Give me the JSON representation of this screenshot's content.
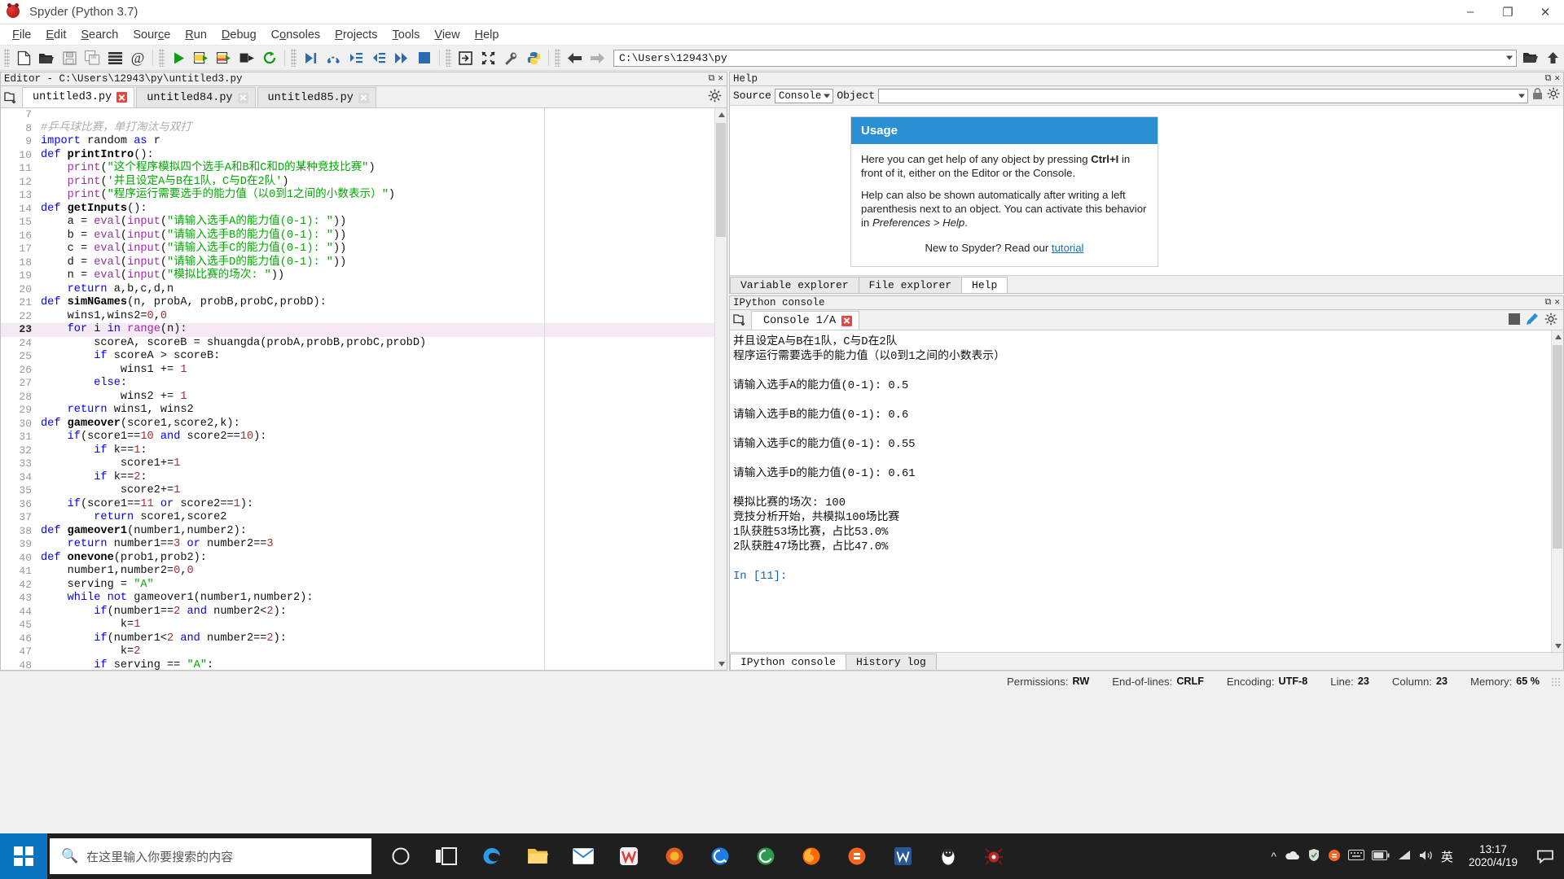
{
  "window": {
    "title": "Spyder (Python 3.7)",
    "buttons": {
      "minimize": "–",
      "maximize": "❐",
      "close": "✕"
    }
  },
  "menubar": [
    {
      "label": "File"
    },
    {
      "label": "Edit"
    },
    {
      "label": "Search"
    },
    {
      "label": "Source"
    },
    {
      "label": "Run"
    },
    {
      "label": "Debug"
    },
    {
      "label": "Consoles"
    },
    {
      "label": "Projects"
    },
    {
      "label": "Tools"
    },
    {
      "label": "View"
    },
    {
      "label": "Help"
    }
  ],
  "toolbar": {
    "path_value": "C:\\Users\\12943\\py",
    "icons": [
      "new-file-icon",
      "open-file-icon",
      "save-file-icon",
      "save-all-icon",
      "file-switcher-icon",
      "find-symbol-icon",
      "run-file-icon",
      "run-cell-icon",
      "run-cell-advance-icon",
      "run-selection-icon",
      "rerun-icon",
      "debug-file-icon",
      "step-over-icon",
      "step-into-icon",
      "step-return-icon",
      "continue-icon",
      "stop-debug-icon",
      "maximize-pane-icon",
      "fullscreen-icon",
      "preferences-icon",
      "pythonpath-icon",
      "back-icon",
      "forward-icon"
    ]
  },
  "editor": {
    "pane_title": "Editor - C:\\Users\\12943\\py\\untitled3.py",
    "tabs": [
      {
        "label": "untitled3.py",
        "active": true
      },
      {
        "label": "untitled84.py",
        "active": false
      },
      {
        "label": "untitled85.py",
        "active": false
      }
    ],
    "current_line": 23,
    "lines": [
      {
        "n": 7,
        "segs": []
      },
      {
        "n": 8,
        "segs": [
          {
            "t": "#乒乓球比赛，单打淘汰与双打",
            "c": "cm"
          }
        ]
      },
      {
        "n": 9,
        "segs": [
          {
            "t": "import",
            "c": "kw"
          },
          {
            "t": " random ",
            "c": "op"
          },
          {
            "t": "as",
            "c": "kw"
          },
          {
            "t": " r",
            "c": "op"
          }
        ]
      },
      {
        "n": 10,
        "segs": [
          {
            "t": "def ",
            "c": "kw"
          },
          {
            "t": "printIntro",
            "c": "fn"
          },
          {
            "t": "():",
            "c": "op"
          }
        ]
      },
      {
        "n": 11,
        "segs": [
          {
            "t": "    ",
            "c": "op"
          },
          {
            "t": "print",
            "c": "bi"
          },
          {
            "t": "(",
            "c": "op"
          },
          {
            "t": "\"这个程序模拟四个选手A和B和C和D的某种竞技比赛\"",
            "c": "st"
          },
          {
            "t": ")",
            "c": "op"
          }
        ]
      },
      {
        "n": 12,
        "segs": [
          {
            "t": "    ",
            "c": "op"
          },
          {
            "t": "print",
            "c": "bi"
          },
          {
            "t": "(",
            "c": "op"
          },
          {
            "t": "'并且设定A与B在1队，C与D在2队'",
            "c": "st"
          },
          {
            "t": ")",
            "c": "op"
          }
        ]
      },
      {
        "n": 13,
        "segs": [
          {
            "t": "    ",
            "c": "op"
          },
          {
            "t": "print",
            "c": "bi"
          },
          {
            "t": "(",
            "c": "op"
          },
          {
            "t": "\"程序运行需要选手的能力值（以0到1之间的小数表示）\"",
            "c": "st"
          },
          {
            "t": ")",
            "c": "op"
          }
        ]
      },
      {
        "n": 14,
        "segs": [
          {
            "t": "def ",
            "c": "kw"
          },
          {
            "t": "getInputs",
            "c": "fn"
          },
          {
            "t": "():",
            "c": "op"
          }
        ]
      },
      {
        "n": 15,
        "segs": [
          {
            "t": "    a = ",
            "c": "op"
          },
          {
            "t": "eval",
            "c": "bi"
          },
          {
            "t": "(",
            "c": "op"
          },
          {
            "t": "input",
            "c": "bi"
          },
          {
            "t": "(",
            "c": "op"
          },
          {
            "t": "\"请输入选手A的能力值(0-1): \"",
            "c": "st"
          },
          {
            "t": "))",
            "c": "op"
          }
        ]
      },
      {
        "n": 16,
        "segs": [
          {
            "t": "    b = ",
            "c": "op"
          },
          {
            "t": "eval",
            "c": "bi"
          },
          {
            "t": "(",
            "c": "op"
          },
          {
            "t": "input",
            "c": "bi"
          },
          {
            "t": "(",
            "c": "op"
          },
          {
            "t": "\"请输入选手B的能力值(0-1): \"",
            "c": "st"
          },
          {
            "t": "))",
            "c": "op"
          }
        ]
      },
      {
        "n": 17,
        "segs": [
          {
            "t": "    c = ",
            "c": "op"
          },
          {
            "t": "eval",
            "c": "bi"
          },
          {
            "t": "(",
            "c": "op"
          },
          {
            "t": "input",
            "c": "bi"
          },
          {
            "t": "(",
            "c": "op"
          },
          {
            "t": "\"请输入选手C的能力值(0-1): \"",
            "c": "st"
          },
          {
            "t": "))",
            "c": "op"
          }
        ]
      },
      {
        "n": 18,
        "segs": [
          {
            "t": "    d = ",
            "c": "op"
          },
          {
            "t": "eval",
            "c": "bi"
          },
          {
            "t": "(",
            "c": "op"
          },
          {
            "t": "input",
            "c": "bi"
          },
          {
            "t": "(",
            "c": "op"
          },
          {
            "t": "\"请输入选手D的能力值(0-1): \"",
            "c": "st"
          },
          {
            "t": "))",
            "c": "op"
          }
        ]
      },
      {
        "n": 19,
        "segs": [
          {
            "t": "    n = ",
            "c": "op"
          },
          {
            "t": "eval",
            "c": "bi"
          },
          {
            "t": "(",
            "c": "op"
          },
          {
            "t": "input",
            "c": "bi"
          },
          {
            "t": "(",
            "c": "op"
          },
          {
            "t": "\"模拟比赛的场次: \"",
            "c": "st"
          },
          {
            "t": "))",
            "c": "op"
          }
        ]
      },
      {
        "n": 20,
        "segs": [
          {
            "t": "    ",
            "c": "op"
          },
          {
            "t": "return",
            "c": "kw"
          },
          {
            "t": " a,b,c,d,n",
            "c": "op"
          }
        ]
      },
      {
        "n": 21,
        "segs": [
          {
            "t": "def ",
            "c": "kw"
          },
          {
            "t": "simNGames",
            "c": "fn"
          },
          {
            "t": "(n, probA, probB,probC,probD):",
            "c": "op"
          }
        ]
      },
      {
        "n": 22,
        "segs": [
          {
            "t": "    wins1,wins2=",
            "c": "op"
          },
          {
            "t": "0",
            "c": "nm"
          },
          {
            "t": ",",
            "c": "op"
          },
          {
            "t": "0",
            "c": "nm"
          }
        ]
      },
      {
        "n": 23,
        "segs": [
          {
            "t": "    ",
            "c": "op"
          },
          {
            "t": "for",
            "c": "kw"
          },
          {
            "t": " i ",
            "c": "op"
          },
          {
            "t": "in",
            "c": "kw"
          },
          {
            "t": " ",
            "c": "op"
          },
          {
            "t": "range",
            "c": "bi"
          },
          {
            "t": "(n):",
            "c": "op"
          }
        ]
      },
      {
        "n": 24,
        "segs": [
          {
            "t": "        scoreA, scoreB = shuangda(probA,probB,probC,probD)",
            "c": "op"
          }
        ]
      },
      {
        "n": 25,
        "segs": [
          {
            "t": "        ",
            "c": "op"
          },
          {
            "t": "if",
            "c": "kw"
          },
          {
            "t": " scoreA > scoreB:",
            "c": "op"
          }
        ]
      },
      {
        "n": 26,
        "segs": [
          {
            "t": "            wins1 += ",
            "c": "op"
          },
          {
            "t": "1",
            "c": "nm"
          }
        ]
      },
      {
        "n": 27,
        "segs": [
          {
            "t": "        ",
            "c": "op"
          },
          {
            "t": "else",
            "c": "kw"
          },
          {
            "t": ":",
            "c": "op"
          }
        ]
      },
      {
        "n": 28,
        "segs": [
          {
            "t": "            wins2 += ",
            "c": "op"
          },
          {
            "t": "1",
            "c": "nm"
          }
        ]
      },
      {
        "n": 29,
        "segs": [
          {
            "t": "    ",
            "c": "op"
          },
          {
            "t": "return",
            "c": "kw"
          },
          {
            "t": " wins1, wins2",
            "c": "op"
          }
        ]
      },
      {
        "n": 30,
        "segs": [
          {
            "t": "def ",
            "c": "kw"
          },
          {
            "t": "gameover",
            "c": "fn"
          },
          {
            "t": "(score1,score2,k):",
            "c": "op"
          }
        ]
      },
      {
        "n": 31,
        "segs": [
          {
            "t": "    ",
            "c": "op"
          },
          {
            "t": "if",
            "c": "kw"
          },
          {
            "t": "(score1==",
            "c": "op"
          },
          {
            "t": "10",
            "c": "nm"
          },
          {
            "t": " ",
            "c": "op"
          },
          {
            "t": "and",
            "c": "kw"
          },
          {
            "t": " score2==",
            "c": "op"
          },
          {
            "t": "10",
            "c": "nm"
          },
          {
            "t": "):",
            "c": "op"
          }
        ]
      },
      {
        "n": 32,
        "segs": [
          {
            "t": "        ",
            "c": "op"
          },
          {
            "t": "if",
            "c": "kw"
          },
          {
            "t": " k==",
            "c": "op"
          },
          {
            "t": "1",
            "c": "nm"
          },
          {
            "t": ":",
            "c": "op"
          }
        ]
      },
      {
        "n": 33,
        "segs": [
          {
            "t": "            score1+=",
            "c": "op"
          },
          {
            "t": "1",
            "c": "nm"
          }
        ]
      },
      {
        "n": 34,
        "segs": [
          {
            "t": "        ",
            "c": "op"
          },
          {
            "t": "if",
            "c": "kw"
          },
          {
            "t": " k==",
            "c": "op"
          },
          {
            "t": "2",
            "c": "nm"
          },
          {
            "t": ":",
            "c": "op"
          }
        ]
      },
      {
        "n": 35,
        "segs": [
          {
            "t": "            score2+=",
            "c": "op"
          },
          {
            "t": "1",
            "c": "nm"
          }
        ]
      },
      {
        "n": 36,
        "segs": [
          {
            "t": "    ",
            "c": "op"
          },
          {
            "t": "if",
            "c": "kw"
          },
          {
            "t": "(score1==",
            "c": "op"
          },
          {
            "t": "11",
            "c": "nm"
          },
          {
            "t": " ",
            "c": "op"
          },
          {
            "t": "or",
            "c": "kw"
          },
          {
            "t": " score2==",
            "c": "op"
          },
          {
            "t": "1",
            "c": "nm"
          },
          {
            "t": "):",
            "c": "op"
          }
        ]
      },
      {
        "n": 37,
        "segs": [
          {
            "t": "        ",
            "c": "op"
          },
          {
            "t": "return",
            "c": "kw"
          },
          {
            "t": " score1,score2",
            "c": "op"
          }
        ]
      },
      {
        "n": 38,
        "segs": [
          {
            "t": "def ",
            "c": "kw"
          },
          {
            "t": "gameover1",
            "c": "fn"
          },
          {
            "t": "(number1,number2):",
            "c": "op"
          }
        ]
      },
      {
        "n": 39,
        "segs": [
          {
            "t": "    ",
            "c": "op"
          },
          {
            "t": "return",
            "c": "kw"
          },
          {
            "t": " number1==",
            "c": "op"
          },
          {
            "t": "3",
            "c": "nm"
          },
          {
            "t": " ",
            "c": "op"
          },
          {
            "t": "or",
            "c": "kw"
          },
          {
            "t": " number2==",
            "c": "op"
          },
          {
            "t": "3",
            "c": "nm"
          }
        ]
      },
      {
        "n": 40,
        "segs": [
          {
            "t": "def ",
            "c": "kw"
          },
          {
            "t": "onevone",
            "c": "fn"
          },
          {
            "t": "(prob1,prob2):",
            "c": "op"
          }
        ]
      },
      {
        "n": 41,
        "segs": [
          {
            "t": "    number1,number2=",
            "c": "op"
          },
          {
            "t": "0",
            "c": "nm"
          },
          {
            "t": ",",
            "c": "op"
          },
          {
            "t": "0",
            "c": "nm"
          }
        ]
      },
      {
        "n": 42,
        "segs": [
          {
            "t": "    serving = ",
            "c": "op"
          },
          {
            "t": "\"A\"",
            "c": "st"
          }
        ]
      },
      {
        "n": 43,
        "segs": [
          {
            "t": "    ",
            "c": "op"
          },
          {
            "t": "while",
            "c": "kw"
          },
          {
            "t": " ",
            "c": "op"
          },
          {
            "t": "not",
            "c": "kw"
          },
          {
            "t": " gameover1(number1,number2):",
            "c": "op"
          }
        ]
      },
      {
        "n": 44,
        "segs": [
          {
            "t": "        ",
            "c": "op"
          },
          {
            "t": "if",
            "c": "kw"
          },
          {
            "t": "(number1==",
            "c": "op"
          },
          {
            "t": "2",
            "c": "nm"
          },
          {
            "t": " ",
            "c": "op"
          },
          {
            "t": "and",
            "c": "kw"
          },
          {
            "t": " number2<",
            "c": "op"
          },
          {
            "t": "2",
            "c": "nm"
          },
          {
            "t": "):",
            "c": "op"
          }
        ]
      },
      {
        "n": 45,
        "segs": [
          {
            "t": "            k=",
            "c": "op"
          },
          {
            "t": "1",
            "c": "nm"
          }
        ]
      },
      {
        "n": 46,
        "segs": [
          {
            "t": "        ",
            "c": "op"
          },
          {
            "t": "if",
            "c": "kw"
          },
          {
            "t": "(number1<",
            "c": "op"
          },
          {
            "t": "2",
            "c": "nm"
          },
          {
            "t": " ",
            "c": "op"
          },
          {
            "t": "and",
            "c": "kw"
          },
          {
            "t": " number2==",
            "c": "op"
          },
          {
            "t": "2",
            "c": "nm"
          },
          {
            "t": "):",
            "c": "op"
          }
        ]
      },
      {
        "n": 47,
        "segs": [
          {
            "t": "            k=",
            "c": "op"
          },
          {
            "t": "2",
            "c": "nm"
          }
        ]
      },
      {
        "n": 48,
        "segs": [
          {
            "t": "        ",
            "c": "op"
          },
          {
            "t": "if",
            "c": "kw"
          },
          {
            "t": " serving == ",
            "c": "op"
          },
          {
            "t": "\"A\"",
            "c": "st"
          },
          {
            "t": ":",
            "c": "op"
          }
        ]
      }
    ]
  },
  "help": {
    "pane_title": "Help",
    "source_label": "Source",
    "source_value": "Console",
    "object_label": "Object",
    "object_value": "",
    "card": {
      "heading": "Usage",
      "p1_a": "Here you can get help of any object by pressing ",
      "p1_b": "Ctrl+I",
      "p1_c": " in front of it, either on the Editor or the Console.",
      "p2_a": "Help can also be shown automatically after writing a left parenthesis next to an object. You can activate this behavior in ",
      "p2_b": "Preferences > Help",
      "p2_c": ".",
      "p3_a": "New to Spyder? Read our ",
      "p3_link": "tutorial"
    },
    "tabs": [
      {
        "label": "Variable explorer",
        "active": false
      },
      {
        "label": "File explorer",
        "active": false
      },
      {
        "label": "Help",
        "active": true
      }
    ]
  },
  "console": {
    "pane_title": "IPython console",
    "tab_label": "Console 1/A",
    "output": [
      "并且设定A与B在1队，C与D在2队",
      "程序运行需要选手的能力值（以0到1之间的小数表示）",
      "",
      "请输入选手A的能力值(0-1): 0.5",
      "",
      "请输入选手B的能力值(0-1): 0.6",
      "",
      "请输入选手C的能力值(0-1): 0.55",
      "",
      "请输入选手D的能力值(0-1): 0.61",
      "",
      "模拟比赛的场次: 100",
      "竞技分析开始，共模拟100场比赛",
      "1队获胜53场比赛，占比53.0%",
      "2队获胜47场比赛，占比47.0%",
      ""
    ],
    "prompt": "In [11]:",
    "tabs": [
      {
        "label": "IPython console",
        "active": true
      },
      {
        "label": "History log",
        "active": false
      }
    ]
  },
  "statusbar": {
    "permissions_label": "Permissions:",
    "permissions_value": "RW",
    "eol_label": "End-of-lines:",
    "eol_value": "CRLF",
    "encoding_label": "Encoding:",
    "encoding_value": "UTF-8",
    "line_label": "Line:",
    "line_value": "23",
    "column_label": "Column:",
    "column_value": "23",
    "memory_label": "Memory:",
    "memory_value": "65 %"
  },
  "taskbar": {
    "search_placeholder": "在这里输入你要搜索的内容",
    "clock_time": "13:17",
    "clock_date": "2020/4/19",
    "ime_label": "英"
  },
  "colors": {
    "accent": "#2b8fd4",
    "taskbar_bg": "#1f1f1f",
    "start_bg": "#0a73c2",
    "current_line": "#f6e9f6",
    "keyword": "#0000ff",
    "string": "#00aa00",
    "builtin": "#9b30a0",
    "number": "#a03030",
    "comment": "#adadad"
  }
}
